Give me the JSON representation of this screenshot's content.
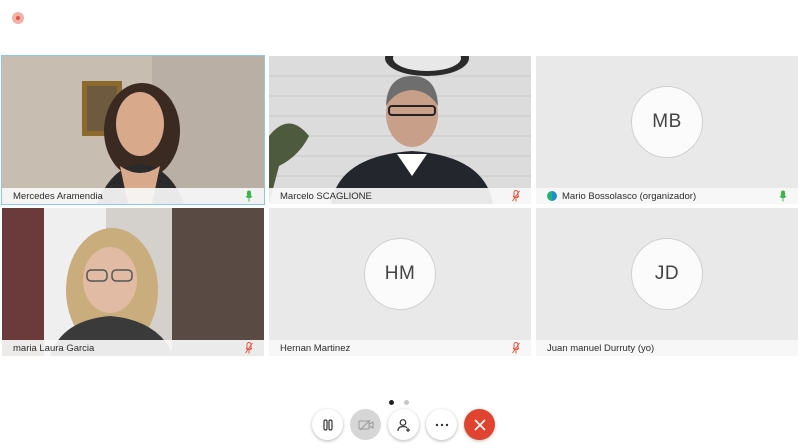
{
  "participants": [
    {
      "name": "Mercedes Aramendia",
      "mic": "on"
    },
    {
      "name": "Marcelo SCAGLIONE",
      "mic": "muted"
    },
    {
      "name": "Mario Bossolasco (organizador)",
      "initials": "MB",
      "mic": "on"
    },
    {
      "name": "maria Laura Garcia",
      "mic": "muted"
    },
    {
      "name": "Hernan Martinez",
      "initials": "HM",
      "mic": "muted"
    },
    {
      "name": "Juan manuel Durruty (yo)",
      "initials": "JD"
    }
  ],
  "pager": {
    "pages": 2,
    "current": 1
  },
  "controls": [
    {
      "icon": "pause-icon"
    },
    {
      "icon": "video-off-icon",
      "disabled": true
    },
    {
      "icon": "participants-icon"
    },
    {
      "icon": "more-icon"
    },
    {
      "icon": "hang-up-icon"
    }
  ],
  "colors": {
    "mic_on": "#3bb54a",
    "mic_muted": "#e05243",
    "end_call": "#e0432f",
    "active_border": "#89c9ea"
  }
}
